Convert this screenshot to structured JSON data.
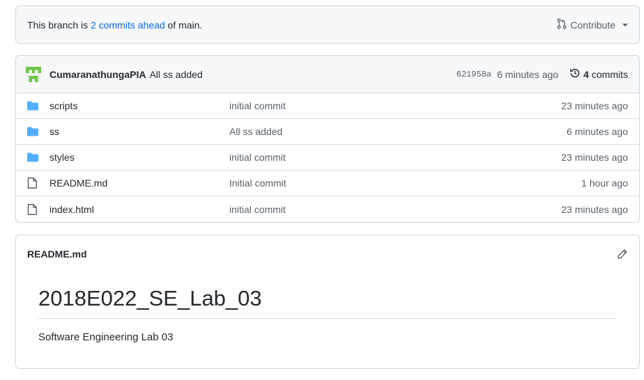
{
  "branch_status": {
    "prefix": "This branch is ",
    "link": "2 commits ahead",
    "suffix": " of main.",
    "contribute_label": "Contribute"
  },
  "latest_commit": {
    "author": "CumaranathungaPIA",
    "message": "All ss added",
    "sha": "621958a",
    "time": "6 minutes ago",
    "commits_count": "4",
    "commits_label": "commits"
  },
  "files": [
    {
      "type": "folder",
      "name": "scripts",
      "commit": "initial commit",
      "age": "23 minutes ago"
    },
    {
      "type": "folder",
      "name": "ss",
      "commit": "All ss added",
      "age": "6 minutes ago"
    },
    {
      "type": "folder",
      "name": "styles",
      "commit": "initial commit",
      "age": "23 minutes ago"
    },
    {
      "type": "file",
      "name": "README.md",
      "commit": "Initial commit",
      "age": "1 hour ago"
    },
    {
      "type": "file",
      "name": "index.html",
      "commit": "initial commit",
      "age": "23 minutes ago"
    }
  ],
  "readme": {
    "filename": "README.md",
    "heading": "2018E022_SE_Lab_03",
    "description": "Software Engineering Lab 03"
  },
  "colors": {
    "link": "#0969da",
    "folder": "#54aeff",
    "avatar": "#6cc644"
  }
}
